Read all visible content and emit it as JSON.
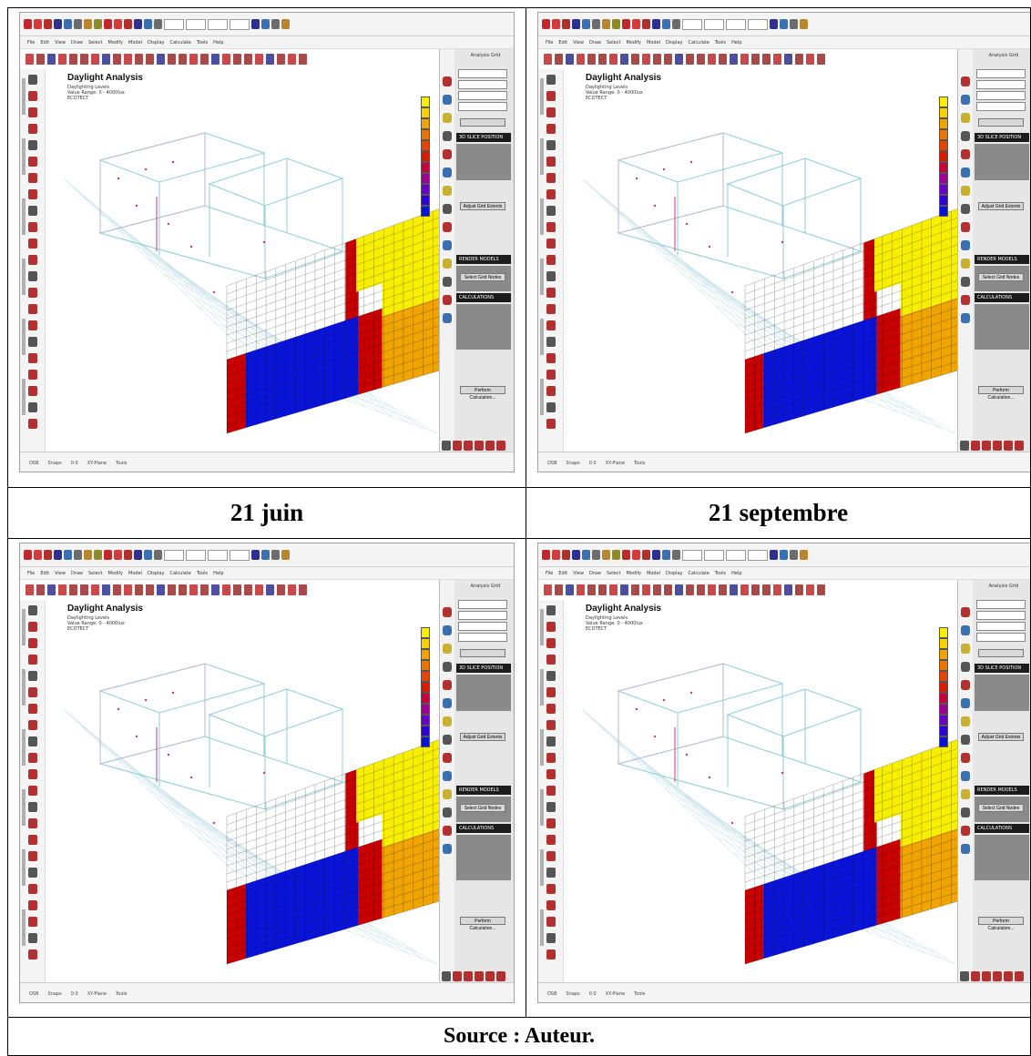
{
  "captions": {
    "top_left": "21 juin",
    "top_right": "21 septembre",
    "source": "Source : Auteur."
  },
  "screenshot": {
    "title": "Daylight Analysis",
    "subtitle_lines": [
      "Daylighting Levels",
      "Value Range: 0 - 4000lux",
      "ECOTECT"
    ],
    "panel_header": "Analysis Grid",
    "panel_sections": [
      "3D SLICE POSITION",
      "RENDER MODELS",
      "CALCULATIONS"
    ],
    "panel_buttons": [
      "Adjust Grid Extents",
      "Select Grid Nodes",
      "Perform Calculation..."
    ],
    "menu_items": [
      "File",
      "Edit",
      "View",
      "Draw",
      "Select",
      "Modify",
      "Model",
      "Display",
      "Calculate",
      "Tools",
      "Help"
    ],
    "status_items": [
      "OSB",
      "Snaps",
      "0.0",
      "XY-Plane",
      "Tools"
    ],
    "colors": {
      "red": "#c80000",
      "blue": "#0a14d8",
      "yellow": "#f8ef00",
      "orange": "#f0a400",
      "wireframe_blue": "#8ccdd8",
      "wireframe_pink": "#e3a0c6"
    },
    "scale_colors": [
      "#f8ef00",
      "#f6d300",
      "#f2a300",
      "#ee7400",
      "#e64400",
      "#dc1a00",
      "#c8003c",
      "#a0009a",
      "#6a00c8",
      "#3000d8",
      "#0a14d8"
    ]
  }
}
